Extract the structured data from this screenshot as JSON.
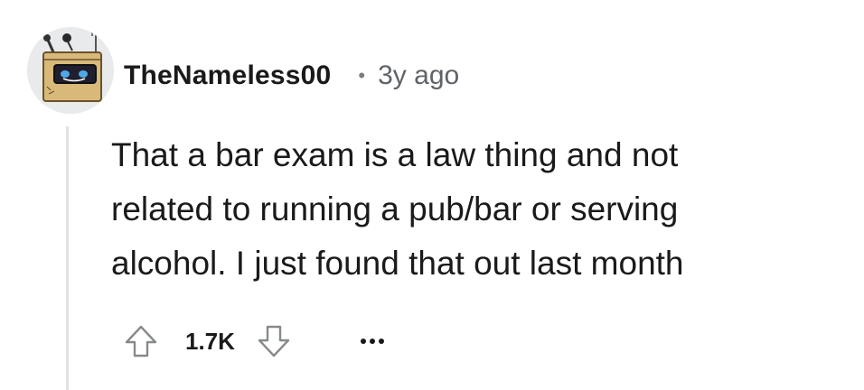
{
  "comment": {
    "author": "TheNameless00",
    "separator": "•",
    "timestamp": "3y ago",
    "body_lines": [
      "That a bar exam is a law thing and not",
      "related to running a pub/bar or serving",
      "alcohol. I just found that out last month"
    ],
    "score": "1.7K",
    "avatar_icon": "robot-snoo-avatar-icon",
    "upvote_icon": "upvote-arrow-icon",
    "downvote_icon": "downvote-arrow-icon",
    "more_icon": "more-options-icon"
  },
  "colors": {
    "text": "#1a1a1b",
    "meta": "#5f6368",
    "icon": "#878a8c",
    "thread_line": "#dfe1e4",
    "background": "#ffffff"
  }
}
